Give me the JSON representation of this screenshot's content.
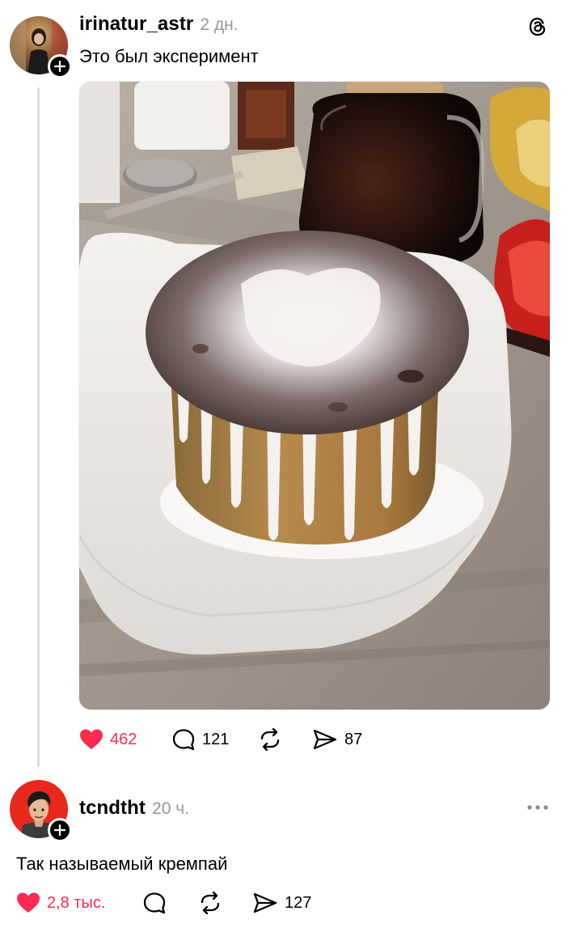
{
  "post": {
    "username": "irinatur_astr",
    "time": "2 дн.",
    "text": "Это был эксперимент",
    "likes": "462",
    "replies": "121",
    "reposts": "",
    "shares": "87",
    "like_color": "#ff2a50"
  },
  "reply": {
    "username": "tcndtht",
    "time": "20 ч.",
    "text": "Так называемый кремпай",
    "likes": "2,8 тыс.",
    "replies": "",
    "reposts": "",
    "shares": "127"
  },
  "icons": {
    "app": "threads-logo-icon",
    "like": "heart-icon",
    "reply": "speech-bubble-icon",
    "repost": "repost-arrows-icon",
    "share": "paper-plane-icon",
    "follow": "plus-icon",
    "more": "ellipsis-icon"
  }
}
